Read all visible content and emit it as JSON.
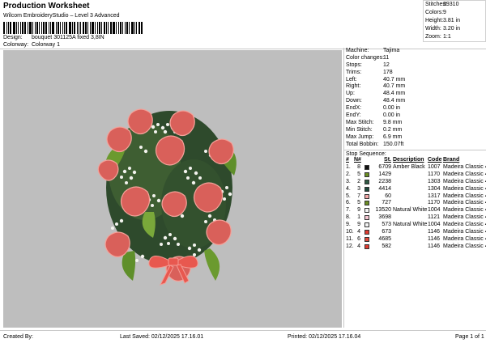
{
  "header": {
    "title": "Production Worksheet",
    "subtitle": "Wilcom EmbroideryStudio – Level 3 Advanced",
    "design_label": "Design:",
    "design_value": "bouquet 301125A fixed  3,8IN",
    "colorway_label": "Colorway:",
    "colorway_value": "Colorway 1"
  },
  "summary": [
    {
      "label": "Stitches:",
      "value": "39310"
    },
    {
      "label": "Colors:",
      "value": "9"
    },
    {
      "label": "Height:",
      "value": "3.81 in"
    },
    {
      "label": "Width:",
      "value": "3.20 in"
    },
    {
      "label": "Zoom:",
      "value": "1:1"
    }
  ],
  "machine_info": [
    {
      "label": "Machine:",
      "value": "Tajima"
    },
    {
      "label": "Color changes:",
      "value": "11"
    },
    {
      "label": "Stops:",
      "value": "12"
    },
    {
      "label": "Trims:",
      "value": "178"
    },
    {
      "label": "Left:",
      "value": "40.7 mm"
    },
    {
      "label": "Right:",
      "value": "40.7 mm"
    },
    {
      "label": "Up:",
      "value": "48.4 mm"
    },
    {
      "label": "Down:",
      "value": "48.4 mm"
    },
    {
      "label": "EndX:",
      "value": "0.00 in"
    },
    {
      "label": "EndY:",
      "value": "0.00 in"
    },
    {
      "label": "Max Stitch:",
      "value": "9.8 mm"
    },
    {
      "label": "Min Stitch:",
      "value": "0.2 mm"
    },
    {
      "label": "Max Jump:",
      "value": "6.9 mm"
    },
    {
      "label": "Total Bobbin:",
      "value": "150.07ft"
    }
  ],
  "stop_sequence": {
    "title": "Stop Sequence:",
    "headers": {
      "num": "#",
      "nf": "N#",
      "st": "St.",
      "desc": "Description",
      "code": "Code",
      "brand": "Brand"
    },
    "rows": [
      {
        "num": "1.",
        "nf": "8",
        "color": "#111111",
        "st": "6709",
        "desc": "Amber Black",
        "code": "1007",
        "brand": "Madeira Classic 40"
      },
      {
        "num": "2.",
        "nf": "5",
        "color": "#6b8e23",
        "st": "1429",
        "desc": "",
        "code": "1170",
        "brand": "Madeira Classic 40"
      },
      {
        "num": "3.",
        "nf": "2",
        "color": "#2f5a43",
        "st": "2238",
        "desc": "",
        "code": "1303",
        "brand": "Madeira Classic 40"
      },
      {
        "num": "4.",
        "nf": "3",
        "color": "#1f4a3c",
        "st": "4414",
        "desc": "",
        "code": "1304",
        "brand": "Madeira Classic 40"
      },
      {
        "num": "5.",
        "nf": "7",
        "color": "#f4a7a7",
        "st": "60",
        "desc": "",
        "code": "1317",
        "brand": "Madeira Classic 40"
      },
      {
        "num": "6.",
        "nf": "5",
        "color": "#6b8e23",
        "st": "727",
        "desc": "",
        "code": "1170",
        "brand": "Madeira Classic 40"
      },
      {
        "num": "7.",
        "nf": "9",
        "color": "#f4f4f4",
        "st": "13520",
        "desc": "Natural White",
        "code": "1004",
        "brand": "Madeira Classic 40"
      },
      {
        "num": "8.",
        "nf": "1",
        "color": "#f6c6d2",
        "st": "3698",
        "desc": "",
        "code": "1121",
        "brand": "Madeira Classic 40"
      },
      {
        "num": "9.",
        "nf": "9",
        "color": "#f4f4f4",
        "st": "573",
        "desc": "Natural White",
        "code": "1004",
        "brand": "Madeira Classic 40"
      },
      {
        "num": "10.",
        "nf": "4",
        "color": "#e03c32",
        "st": "673",
        "desc": "",
        "code": "1146",
        "brand": "Madeira Classic 40"
      },
      {
        "num": "11.",
        "nf": "6",
        "color": "#e04a3c",
        "st": "4685",
        "desc": "",
        "code": "1146",
        "brand": "Madeira Classic 40"
      },
      {
        "num": "12.",
        "nf": "4",
        "color": "#e03c32",
        "st": "582",
        "desc": "",
        "code": "1146",
        "brand": "Madeira Classic 40"
      }
    ]
  },
  "footer": {
    "created_by": "Created By:",
    "last_saved": "Last Saved: 02/12/2025 17.16.01",
    "printed": "Printed: 02/12/2025 17.16.04",
    "page": "Page 1 of 1"
  }
}
